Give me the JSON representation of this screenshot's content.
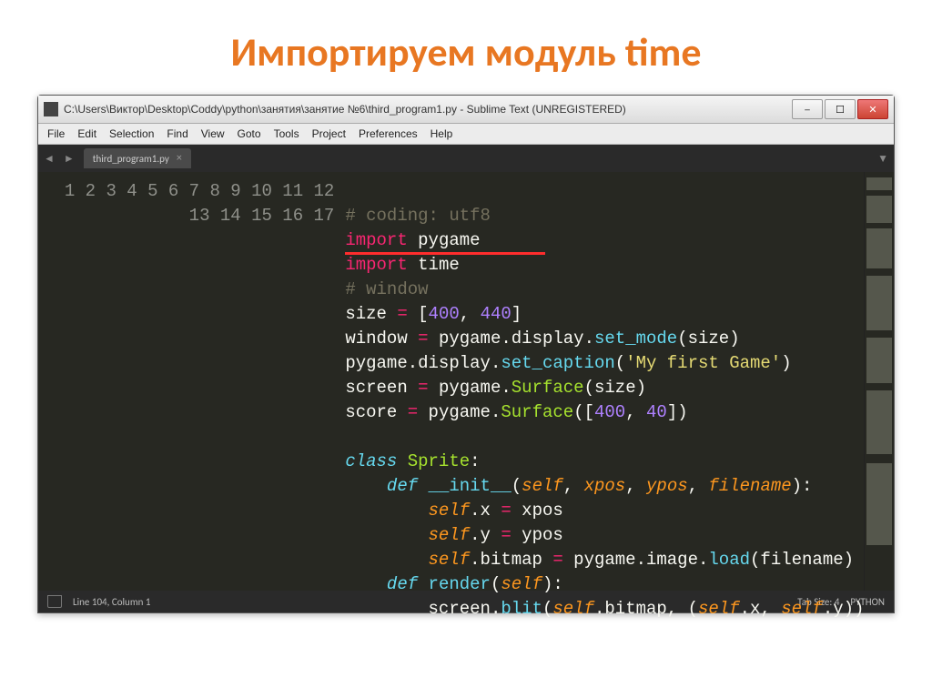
{
  "slide_title": "Импортируем модуль time",
  "window_title": "C:\\Users\\Виктор\\Desktop\\Coddy\\python\\занятия\\занятие №6\\third_program1.py - Sublime Text (UNREGISTERED)",
  "menu": [
    "File",
    "Edit",
    "Selection",
    "Find",
    "View",
    "Goto",
    "Tools",
    "Project",
    "Preferences",
    "Help"
  ],
  "tab_name": "third_program1.py",
  "code_lines": {
    "l1": {
      "comment": "# coding: utf8"
    },
    "l2": {
      "kw": "import",
      "mod": "pygame"
    },
    "l3": {
      "kw": "import",
      "mod": "time"
    },
    "l4": {
      "comment": "# window"
    },
    "l5": {
      "var": "size ",
      "op": "=",
      "rest": " [",
      "n1": "400",
      "c": ", ",
      "n2": "440",
      "end": "]"
    },
    "l6": {
      "var": "window ",
      "op": "=",
      "obj": " pygame.display.",
      "fn": "set_mode",
      "args": "(size)"
    },
    "l7": {
      "obj": "pygame.display.",
      "fn": "set_caption",
      "open": "(",
      "str": "'My first Game'",
      "close": ")"
    },
    "l8": {
      "var": "screen ",
      "op": "=",
      "obj": " pygame.",
      "cls": "Surface",
      "args": "(size)"
    },
    "l9": {
      "var": "score ",
      "op": "=",
      "obj": " pygame.",
      "cls": "Surface",
      "open": "([",
      "n1": "400",
      "c": ", ",
      "n2": "40",
      "close": "])"
    },
    "l11": {
      "kw": "class",
      "name": " Sprite",
      "colon": ":"
    },
    "l12": {
      "indent": "    ",
      "kw": "def",
      "name": " __init__",
      "open": "(",
      "p1": "self",
      "c1": ", ",
      "p2": "xpos",
      "c2": ", ",
      "p3": "ypos",
      "c3": ", ",
      "p4": "filename",
      "close": "):"
    },
    "l13": {
      "indent": "        ",
      "self": "self",
      "attr": ".x ",
      "op": "=",
      "rest": " xpos"
    },
    "l14": {
      "indent": "        ",
      "self": "self",
      "attr": ".y ",
      "op": "=",
      "rest": " ypos"
    },
    "l15": {
      "indent": "        ",
      "self": "self",
      "attr": ".bitmap ",
      "op": "=",
      "obj": " pygame.image.",
      "fn": "load",
      "args": "(filename)"
    },
    "l16": {
      "indent": "    ",
      "kw": "def",
      "name": " render",
      "open": "(",
      "p1": "self",
      "close": "):"
    },
    "l17": {
      "indent": "        ",
      "obj1": "screen.",
      "fn": "blit",
      "open": "(",
      "self1": "self",
      "attr1": ".bitmap, (",
      "self2": "self",
      "attr2": ".x, ",
      "self3": "self",
      "attr3": ".y))"
    }
  },
  "status": {
    "position": "Line 104, Column 1",
    "tabsize": "Tab Size: 4",
    "lang": "PYTHON"
  },
  "win_buttons": {
    "min": "─",
    "max": "☐",
    "close": "✕"
  }
}
